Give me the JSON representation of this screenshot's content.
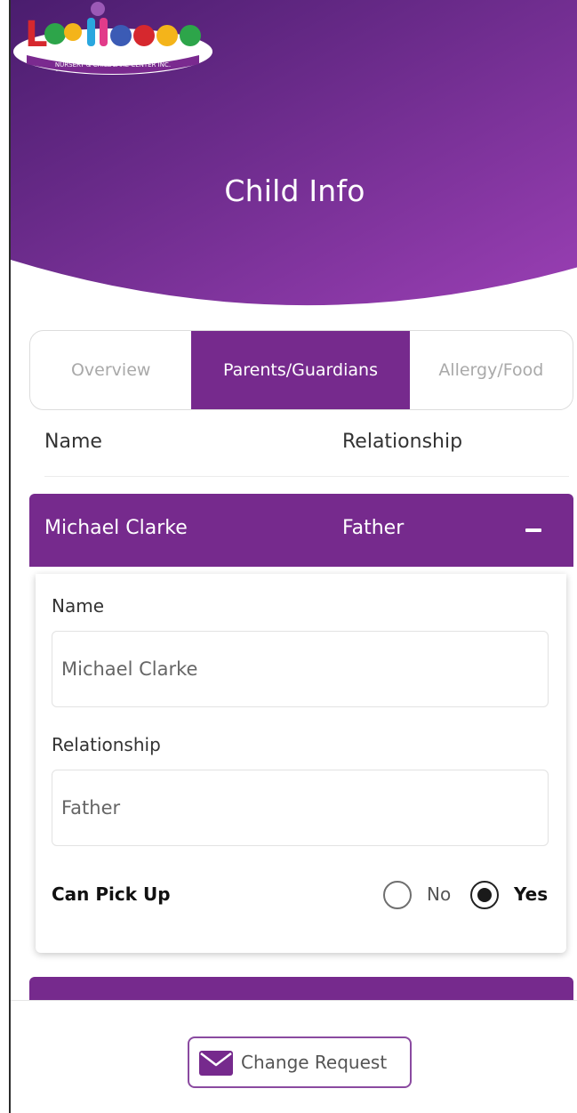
{
  "header": {
    "title": "Child Info",
    "gradient_start": "#4a1d6e",
    "gradient_end": "#9a3fb4",
    "logo": {
      "brand": "Lullaboo",
      "tagline": "NURSERY & CHILDCARE CENTER INC."
    }
  },
  "tabs": [
    {
      "label": "Overview",
      "active": false
    },
    {
      "label": "Parents/Guardians",
      "active": true
    },
    {
      "label": "Allergy/Food",
      "active": false
    }
  ],
  "columns": {
    "name": "Name",
    "relationship": "Relationship"
  },
  "guardians": [
    {
      "name": "Michael Clarke",
      "relationship": "Father",
      "expanded": true,
      "form": {
        "name_label": "Name",
        "name_value": "Michael Clarke",
        "relationship_label": "Relationship",
        "relationship_value": "Father",
        "pickup_label": "Can Pick Up",
        "option_no": "No",
        "option_yes": "Yes",
        "pickup_selected": "Yes"
      }
    }
  ],
  "footer": {
    "change_request_label": "Change Request"
  },
  "colors": {
    "accent": "#762a8d",
    "inactive_text": "#a9a9a9"
  }
}
